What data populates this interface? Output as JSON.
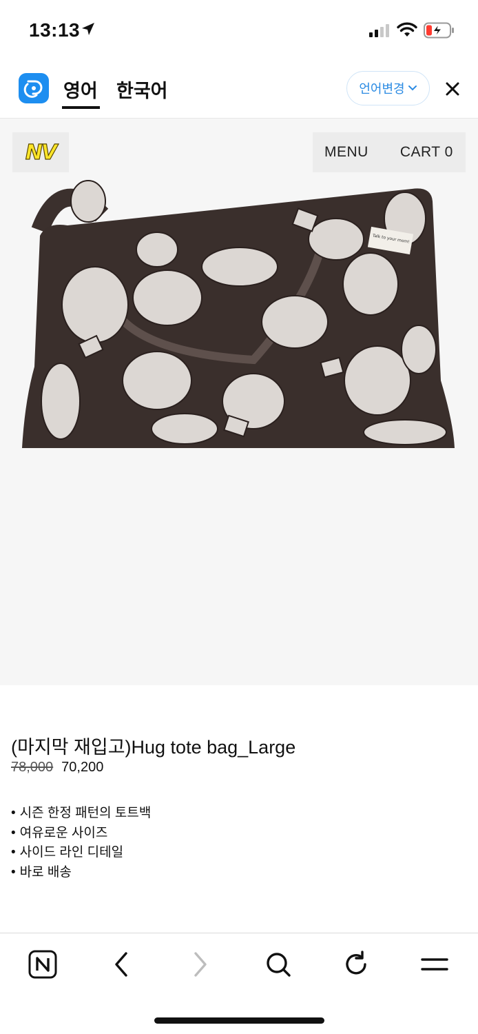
{
  "status_bar": {
    "time": "13:13",
    "icons": [
      "location-arrow-icon",
      "cellular-signal-icon",
      "wifi-icon",
      "battery-low-charging-icon"
    ]
  },
  "translate_bar": {
    "app_icon": "translate-app-icon",
    "tabs": [
      {
        "label": "영어",
        "active": true
      },
      {
        "label": "한국어",
        "active": false
      }
    ],
    "change_language_label": "언어변경",
    "close_icon": "close-icon",
    "accent_color": "#2b8be3"
  },
  "site_header": {
    "logo_text": "NV",
    "menu_label": "MENU",
    "cart_label": "CART 0"
  },
  "product": {
    "title": "(마지막 재입고)Hug tote bag_Large",
    "price_original": "78,000",
    "price_sale": "70,200",
    "features": [
      "시즌 한정 패턴의 토트백",
      "여유로운 사이즈",
      "사이드 라인 디테일",
      "바로 배송"
    ],
    "image_label_text": "Talk to your mom!"
  },
  "browser_toolbar": {
    "buttons": [
      "naver-home-icon",
      "back-icon",
      "forward-icon",
      "search-icon",
      "refresh-icon",
      "menu-icon"
    ]
  }
}
